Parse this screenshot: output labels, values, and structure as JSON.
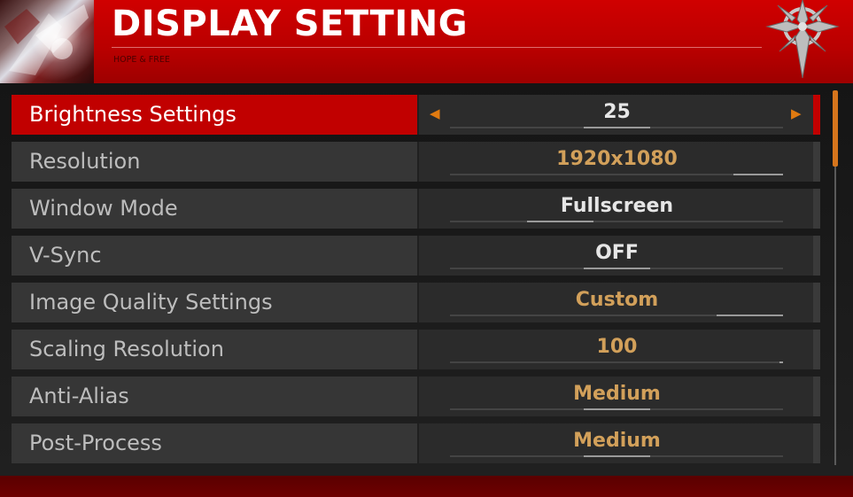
{
  "header": {
    "title": "DISPLAY SETTING",
    "subtitle": "HOPE & FREE",
    "art_icon": "character-portrait-icon",
    "emblem_icon": "compass-emblem-icon"
  },
  "colors": {
    "header_red": "#c80000",
    "active_red": "#c10000",
    "value_gold": "#d2a05a",
    "value_white": "#e6e6e6",
    "arrow_orange": "#e07a10",
    "scroll_orange": "#d6751c"
  },
  "settings": [
    {
      "label": "Brightness Settings",
      "value": "25",
      "active": true,
      "value_color": "white",
      "slider_position": 0.5
    },
    {
      "label": "Resolution",
      "value": "1920x1080",
      "active": false,
      "value_color": "gold",
      "slider_position": 0.95
    },
    {
      "label": "Window Mode",
      "value": "Fullscreen",
      "active": false,
      "value_color": "white",
      "slider_position": 0.33
    },
    {
      "label": "V-Sync",
      "value": "OFF",
      "active": false,
      "value_color": "white",
      "slider_position": 0.5
    },
    {
      "label": "Image Quality Settings",
      "value": "Custom",
      "active": false,
      "value_color": "gold",
      "slider_position": 0.9
    },
    {
      "label": "Scaling Resolution",
      "value": "100",
      "active": false,
      "value_color": "gold",
      "slider_position": 1.0
    },
    {
      "label": "Anti-Alias",
      "value": "Medium",
      "active": false,
      "value_color": "gold",
      "slider_position": 0.5
    },
    {
      "label": "Post-Process",
      "value": "Medium",
      "active": false,
      "value_color": "gold",
      "slider_position": 0.5
    }
  ],
  "arrows": {
    "left": "◀",
    "right": "▶"
  },
  "scrollbar": {
    "position": 0.0,
    "visible_fraction": 0.2
  }
}
